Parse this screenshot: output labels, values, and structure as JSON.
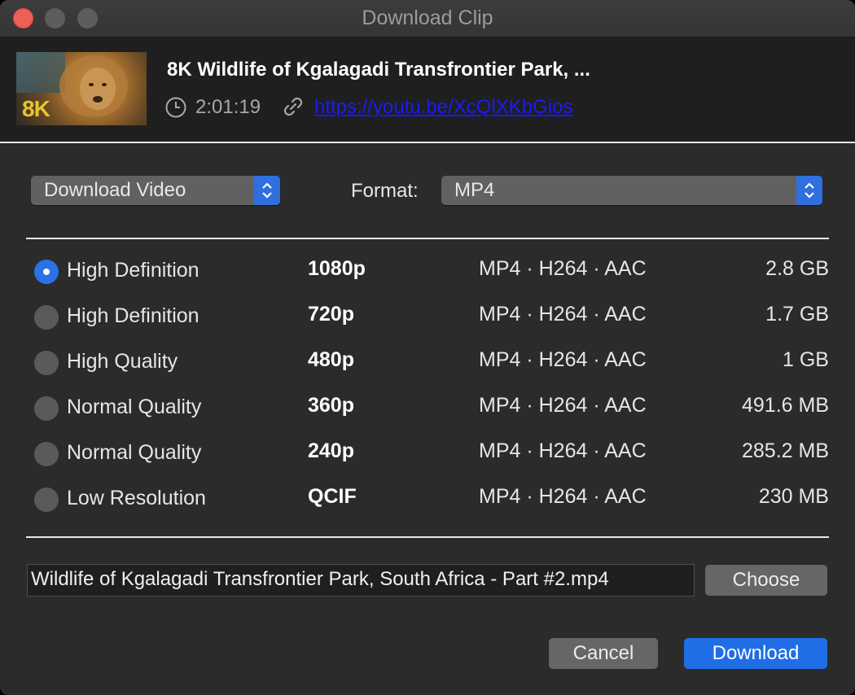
{
  "window": {
    "title": "Download Clip"
  },
  "clip": {
    "title": "8K Wildlife of Kgalagadi Transfrontier Park, ...",
    "duration": "2:01:19",
    "url": "https://youtu.be/XcQlXKbGios",
    "thumbnail_badge": "8K"
  },
  "controls": {
    "mode_select": "Download Video",
    "format_label": "Format:",
    "format_select": "MP4"
  },
  "options": [
    {
      "label": "High Definition",
      "resolution": "1080p",
      "format": "MP4 · H264 · AAC",
      "size": "2.8 GB",
      "selected": true
    },
    {
      "label": "High Definition",
      "resolution": "720p",
      "format": "MP4 · H264 · AAC",
      "size": "1.7 GB",
      "selected": false
    },
    {
      "label": "High Quality",
      "resolution": "480p",
      "format": "MP4 · H264 · AAC",
      "size": "1 GB",
      "selected": false
    },
    {
      "label": "Normal Quality",
      "resolution": "360p",
      "format": "MP4 · H264 · AAC",
      "size": "491.6 MB",
      "selected": false
    },
    {
      "label": "Normal Quality",
      "resolution": "240p",
      "format": "MP4 · H264 · AAC",
      "size": "285.2 MB",
      "selected": false
    },
    {
      "label": "Low Resolution",
      "resolution": "QCIF",
      "format": "MP4 · H264 · AAC",
      "size": "230 MB",
      "selected": false
    }
  ],
  "output": {
    "filename": "Wildlife of Kgalagadi Transfrontier Park, South Africa - Part #2.mp4",
    "choose_label": "Choose"
  },
  "actions": {
    "cancel_label": "Cancel",
    "download_label": "Download"
  },
  "colors": {
    "accent": "#1f6ee6",
    "close": "#ee5f57",
    "link": "#1a1aff"
  },
  "icons": [
    "close-icon",
    "minimize-icon",
    "zoom-icon",
    "clock-icon",
    "link-icon",
    "chevron-updown-icon"
  ]
}
